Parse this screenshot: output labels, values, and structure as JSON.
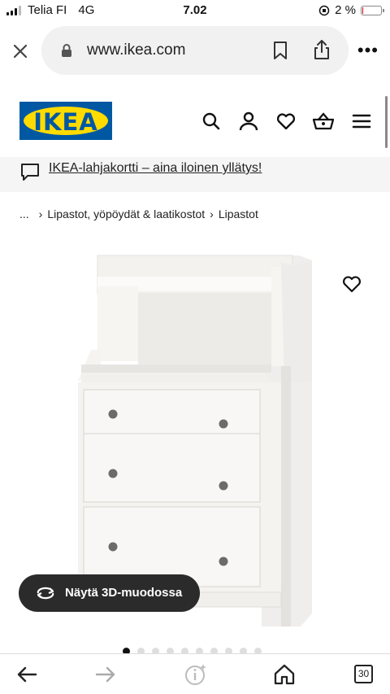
{
  "status_bar": {
    "carrier": "Telia FI",
    "network": "4G",
    "time": "7.02",
    "battery_percent": "2 %",
    "battery_level": 0.02
  },
  "browser": {
    "url": "www.ikea.com",
    "icons": {
      "close": "close-icon",
      "lock": "lock-icon",
      "bookmark": "bookmark-icon",
      "share": "share-icon",
      "more": "more-icon"
    },
    "more_label": "•••"
  },
  "header": {
    "logo_text": "IKEA",
    "icons": [
      "search-icon",
      "user-icon",
      "heart-icon",
      "basket-icon",
      "menu-icon"
    ],
    "colors": {
      "logo_blue": "#0058a3",
      "logo_yellow": "#ffdb00"
    }
  },
  "promo": {
    "text": "IKEA-lahjakortti – aina iloinen yllätys!",
    "icon": "chat-bubble-icon"
  },
  "breadcrumb": {
    "ellipsis": "...",
    "separator": "›",
    "items": [
      "Lipastot, yöpöydät & laatikostot",
      "Lipastot"
    ]
  },
  "product": {
    "image_icon": "dresser-image",
    "favourite_icon": "heart-outline-icon",
    "view_3d_label": "Näytä 3D-muodossa",
    "image_count": 10,
    "active_image": 1
  },
  "bottom_nav": {
    "tabs_count": "30",
    "icons": [
      "back-arrow-icon",
      "forward-arrow-icon",
      "info-sparkle-icon",
      "home-icon",
      "tabs-icon"
    ]
  }
}
